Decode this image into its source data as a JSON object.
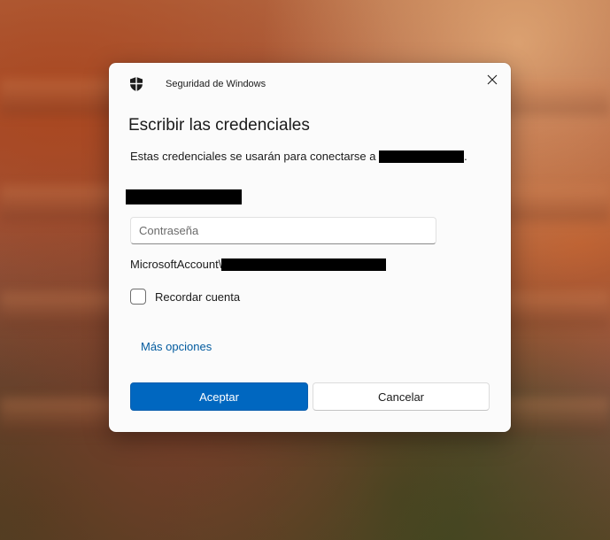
{
  "dialog": {
    "app_title": "Seguridad de Windows",
    "heading": "Escribir las credenciales",
    "description": "Estas credenciales se usarán para conectarse a",
    "description_end": ".",
    "password": {
      "placeholder": "Contraseña",
      "value": ""
    },
    "account_prefix": "MicrosoftAccount\\",
    "remember_label": "Recordar cuenta",
    "remember_checked": false,
    "more_options": "Más opciones",
    "ok_label": "Aceptar",
    "cancel_label": "Cancelar",
    "icons": {
      "app": "shield-icon",
      "close": "close-icon"
    }
  },
  "colors": {
    "accent": "#0067c0",
    "link": "#005a9e",
    "dialog_bg": "#fbfbfb"
  }
}
